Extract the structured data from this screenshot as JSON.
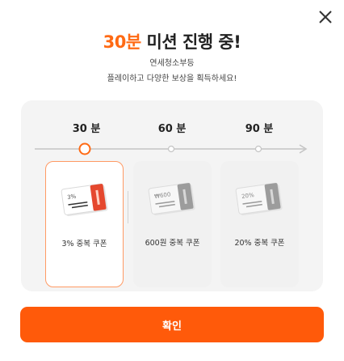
{
  "dialog": {
    "close_icon": "close-icon",
    "title_accent": "30분",
    "title_rest": " 미션 진행 중!",
    "subtitle_line1": "연세청소부등",
    "subtitle_line2": "플레이하고 다양한 보상을 획득하세요!"
  },
  "progress": {
    "steps": [
      {
        "label": "30 분",
        "state": "current"
      },
      {
        "label": "60 분",
        "state": "upcoming"
      },
      {
        "label": "90 분",
        "state": "upcoming"
      }
    ],
    "colors": {
      "accent": "#ff6a14",
      "line": "#c4c4c4"
    }
  },
  "rewards": [
    {
      "label": "3% 중복 쿠폰",
      "ticket_text": "3%",
      "selected": true
    },
    {
      "label": "600원 중복 쿠폰",
      "ticket_text": "₩600",
      "selected": false
    },
    {
      "label": "20% 중복 쿠폰",
      "ticket_text": "20%",
      "selected": false
    }
  ],
  "confirm_button": {
    "label": "확인",
    "color": "#ff5a0a"
  }
}
